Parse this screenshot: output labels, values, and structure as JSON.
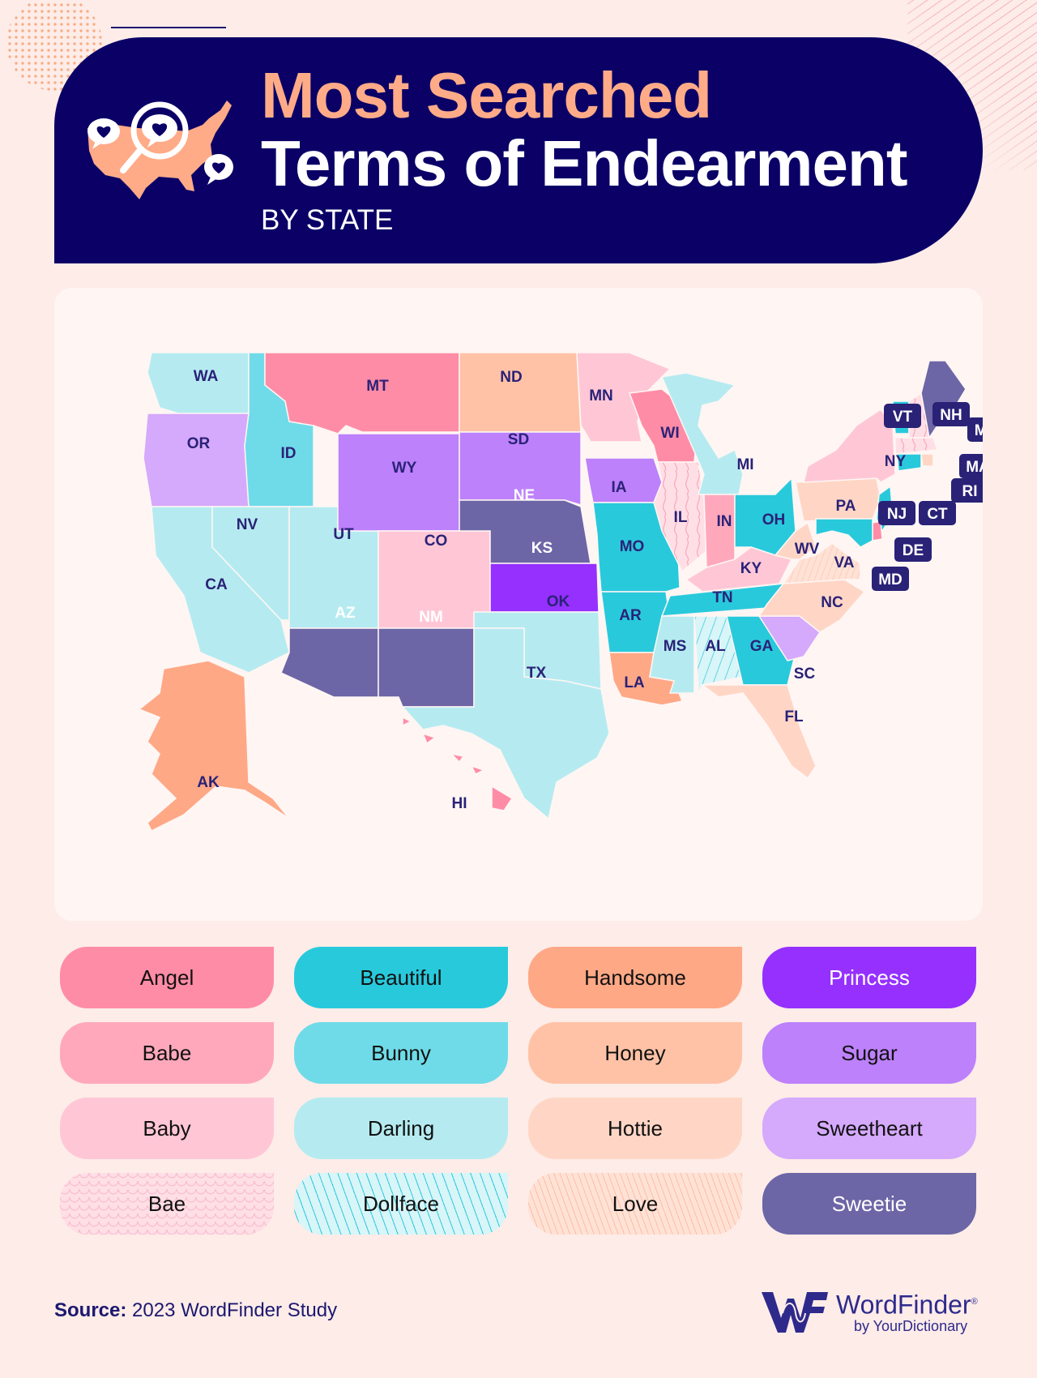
{
  "header": {
    "title_line1": "Most Searched",
    "title_line2": "Terms of Endearment",
    "subtitle": "BY STATE"
  },
  "legend": [
    {
      "term": "Angel",
      "color": "#ff8ca6",
      "pattern": "solid",
      "text_color": "dark"
    },
    {
      "term": "Beautiful",
      "color": "#29c9dc",
      "pattern": "solid",
      "text_color": "dark"
    },
    {
      "term": "Handsome",
      "color": "#ffa886",
      "pattern": "solid",
      "text_color": "dark"
    },
    {
      "term": "Princess",
      "color": "#9530ff",
      "pattern": "solid",
      "text_color": "light"
    },
    {
      "term": "Babe",
      "color": "#ffa8bc",
      "pattern": "solid",
      "text_color": "dark"
    },
    {
      "term": "Bunny",
      "color": "#6fdbe8",
      "pattern": "solid",
      "text_color": "dark"
    },
    {
      "term": "Honey",
      "color": "#ffc2a6",
      "pattern": "solid",
      "text_color": "dark"
    },
    {
      "term": "Sugar",
      "color": "#bd81fb",
      "pattern": "solid",
      "text_color": "dark"
    },
    {
      "term": "Baby",
      "color": "#ffc7d6",
      "pattern": "solid",
      "text_color": "dark"
    },
    {
      "term": "Darling",
      "color": "#b5ebf0",
      "pattern": "solid",
      "text_color": "dark"
    },
    {
      "term": "Hottie",
      "color": "#ffd6c6",
      "pattern": "solid",
      "text_color": "dark"
    },
    {
      "term": "Sweetheart",
      "color": "#d5a9fb",
      "pattern": "solid",
      "text_color": "dark"
    },
    {
      "term": "Bae",
      "color": "#ffdfe6",
      "pattern": "wavy",
      "text_color": "dark"
    },
    {
      "term": "Dollface",
      "color": "#d8f5f8",
      "pattern": "diagonal",
      "text_color": "dark"
    },
    {
      "term": "Love",
      "color": "#ffe2d6",
      "pattern": "diagonal-fine",
      "text_color": "dark"
    },
    {
      "term": "Sweetie",
      "color": "#6c66a6",
      "pattern": "solid",
      "text_color": "light"
    }
  ],
  "states": [
    {
      "abbr": "WA",
      "term": "Darling"
    },
    {
      "abbr": "OR",
      "term": "Sweetheart"
    },
    {
      "abbr": "CA",
      "term": "Darling"
    },
    {
      "abbr": "ID",
      "term": "Bunny"
    },
    {
      "abbr": "NV",
      "term": "Darling"
    },
    {
      "abbr": "UT",
      "term": "Darling"
    },
    {
      "abbr": "AZ",
      "term": "Sweetie"
    },
    {
      "abbr": "MT",
      "term": "Angel"
    },
    {
      "abbr": "WY",
      "term": "Sugar"
    },
    {
      "abbr": "CO",
      "term": "Baby"
    },
    {
      "abbr": "NM",
      "term": "Sweetie"
    },
    {
      "abbr": "ND",
      "term": "Honey"
    },
    {
      "abbr": "SD",
      "term": "Sugar"
    },
    {
      "abbr": "NE",
      "term": "Sweetie"
    },
    {
      "abbr": "KS",
      "term": "Princess"
    },
    {
      "abbr": "OK",
      "term": "Darling"
    },
    {
      "abbr": "TX",
      "term": "Darling"
    },
    {
      "abbr": "MN",
      "term": "Baby"
    },
    {
      "abbr": "IA",
      "term": "Sugar"
    },
    {
      "abbr": "MO",
      "term": "Beautiful"
    },
    {
      "abbr": "AR",
      "term": "Beautiful"
    },
    {
      "abbr": "LA",
      "term": "Handsome"
    },
    {
      "abbr": "WI",
      "term": "Angel"
    },
    {
      "abbr": "IL",
      "term": "Bae"
    },
    {
      "abbr": "MI",
      "term": "Darling"
    },
    {
      "abbr": "IN",
      "term": "Babe"
    },
    {
      "abbr": "OH",
      "term": "Beautiful"
    },
    {
      "abbr": "KY",
      "term": "Baby"
    },
    {
      "abbr": "TN",
      "term": "Beautiful"
    },
    {
      "abbr": "MS",
      "term": "Darling"
    },
    {
      "abbr": "AL",
      "term": "Dollface"
    },
    {
      "abbr": "GA",
      "term": "Beautiful"
    },
    {
      "abbr": "FL",
      "term": "Hottie"
    },
    {
      "abbr": "SC",
      "term": "Sweetheart"
    },
    {
      "abbr": "NC",
      "term": "Hottie"
    },
    {
      "abbr": "VA",
      "term": "Love"
    },
    {
      "abbr": "WV",
      "term": "Hottie"
    },
    {
      "abbr": "PA",
      "term": "Hottie"
    },
    {
      "abbr": "NY",
      "term": "Baby"
    },
    {
      "abbr": "VT",
      "term": "Beautiful"
    },
    {
      "abbr": "NH",
      "term": "Bae"
    },
    {
      "abbr": "ME",
      "term": "Sweetie"
    },
    {
      "abbr": "MA",
      "term": "Bae"
    },
    {
      "abbr": "RI",
      "term": "Hottie"
    },
    {
      "abbr": "CT",
      "term": "Beautiful"
    },
    {
      "abbr": "NJ",
      "term": "Beautiful"
    },
    {
      "abbr": "DE",
      "term": "Angel"
    },
    {
      "abbr": "MD",
      "term": "Beautiful"
    },
    {
      "abbr": "AK",
      "term": "Handsome"
    },
    {
      "abbr": "HI",
      "term": "Angel"
    }
  ],
  "footer": {
    "source_label": "Source:",
    "source_text": "2023 WordFinder Study",
    "brand_name": "WordFinder",
    "brand_reg": "®",
    "brand_sub": "by YourDictionary"
  }
}
